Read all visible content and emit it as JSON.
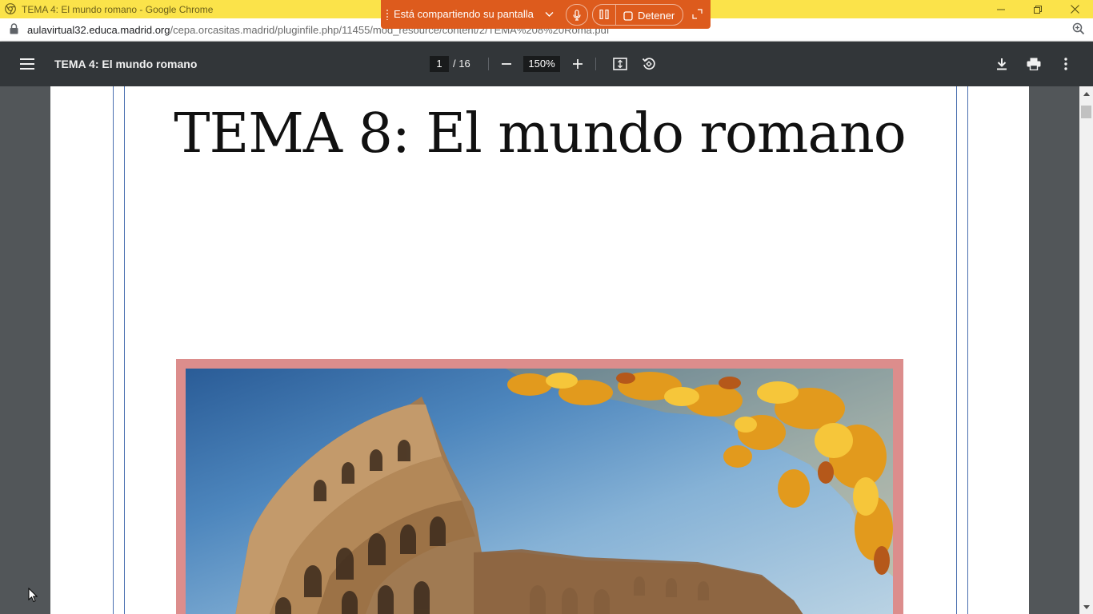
{
  "window": {
    "title": "TEMA 4: El mundo romano - Google Chrome",
    "minimize_icon": "minimize-icon",
    "restore_icon": "restore-icon",
    "close_icon": "close-icon"
  },
  "sharing_bar": {
    "label": "Está compartiendo su pantalla",
    "stop_label": "Detener",
    "color": "#dd5b1d"
  },
  "address": {
    "host": "aulavirtual32.educa.madrid.org",
    "path": "/cepa.orcasitas.madrid/pluginfile.php/11455/mod_resource/content/2/TEMA%208%20Roma.pdf"
  },
  "pdf_toolbar": {
    "doc_title": "TEMA 4: El mundo romano",
    "current_page": "1",
    "total_pages": "/ 16",
    "zoom": "150%",
    "background": "#323639"
  },
  "document": {
    "heading": "TEMA 8: El mundo romano",
    "frame_color": "#dc8d8c"
  }
}
